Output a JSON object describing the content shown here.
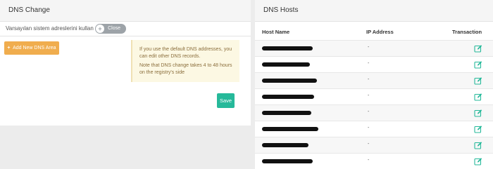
{
  "left_panel": {
    "title": "DNS Change",
    "default_label": "Varsayılan sistem adreslerini kullan",
    "toggle": {
      "state": "Close",
      "icon": "plus-icon"
    },
    "add_button": "Add New DNS Area",
    "info": [
      "If you use the default DNS addresses, you can edit other DNS records.",
      "Note that DNS change takes 4 to 48 hours on the registry's side"
    ],
    "save_button": "Save"
  },
  "right_panel": {
    "title": "DNS Hosts",
    "columns": {
      "host": "Host Name",
      "ip": "IP Address",
      "action": "Transaction"
    },
    "rows": [
      {
        "host": "",
        "ip": "-"
      },
      {
        "host": "",
        "ip": "-"
      },
      {
        "host": "",
        "ip": "-"
      },
      {
        "host": "",
        "ip": "-"
      },
      {
        "host": "",
        "ip": "-"
      },
      {
        "host": "",
        "ip": "-"
      },
      {
        "host": "",
        "ip": "-"
      },
      {
        "host": "",
        "ip": "-"
      }
    ],
    "edit_icon": "edit-icon"
  },
  "colors": {
    "warning": "#f0ad4e",
    "success": "#26b99a",
    "info_bg": "#fcf8e3"
  }
}
